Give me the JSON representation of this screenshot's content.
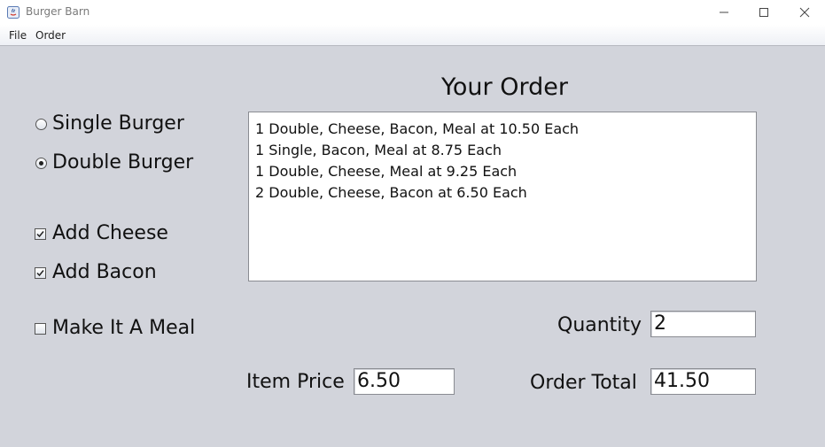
{
  "window": {
    "title": "Burger Barn"
  },
  "menu": {
    "items": [
      "File",
      "Order"
    ]
  },
  "options": {
    "burger_type": [
      {
        "label": "Single Burger",
        "selected": false
      },
      {
        "label": "Double Burger",
        "selected": true
      }
    ],
    "addons": [
      {
        "label": "Add Cheese",
        "checked": true
      },
      {
        "label": "Add Bacon",
        "checked": true
      },
      {
        "label": "Make It A Meal",
        "checked": false
      }
    ]
  },
  "order": {
    "heading": "Your Order",
    "lines": [
      "1 Double, Cheese, Bacon, Meal at 10.50 Each",
      "1 Single, Bacon, Meal at 8.75 Each",
      "1 Double, Cheese, Meal at 9.25 Each",
      "2 Double, Cheese, Bacon at 6.50 Each"
    ]
  },
  "fields": {
    "quantity_label": "Quantity",
    "quantity_value": "2",
    "item_price_label": "Item Price",
    "item_price_value": "6.50",
    "order_total_label": "Order Total",
    "order_total_value": "41.50"
  }
}
